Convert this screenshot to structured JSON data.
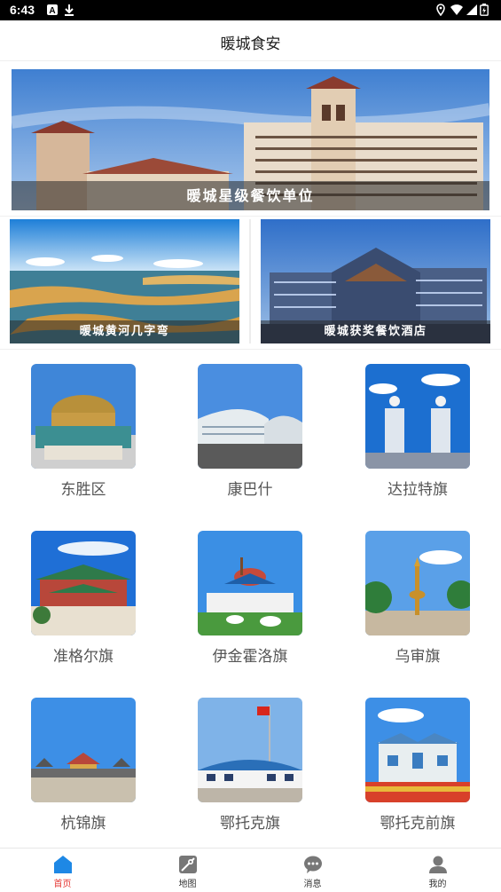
{
  "status_bar": {
    "time": "6:43"
  },
  "header": {
    "title": "暖城食安"
  },
  "hero_banner": {
    "caption": "暖城星级餐饮单位"
  },
  "sub_banners": [
    {
      "caption": "暖城黄河几字弯"
    },
    {
      "caption": "暖城获奖餐饮酒店"
    }
  ],
  "districts": [
    {
      "label": "东胜区"
    },
    {
      "label": "康巴什"
    },
    {
      "label": "达拉特旗"
    },
    {
      "label": "准格尔旗"
    },
    {
      "label": "伊金霍洛旗"
    },
    {
      "label": "乌审旗"
    },
    {
      "label": "杭锦旗"
    },
    {
      "label": "鄂托克旗"
    },
    {
      "label": "鄂托克前旗"
    }
  ],
  "tabbar": {
    "items": [
      {
        "label": "首页",
        "icon": "home-icon",
        "active": true
      },
      {
        "label": "地图",
        "icon": "map-icon",
        "active": false
      },
      {
        "label": "消息",
        "icon": "message-icon",
        "active": false
      },
      {
        "label": "我的",
        "icon": "profile-icon",
        "active": false
      }
    ],
    "active_color": "#e53935",
    "accent_color": "#1e88e5"
  }
}
